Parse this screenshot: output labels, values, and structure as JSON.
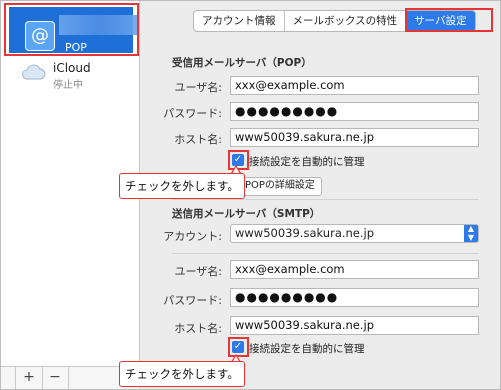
{
  "sidebar": {
    "selected_account": {
      "icon": "at-sign-icon",
      "subtitle": "POP"
    },
    "icloud": {
      "icon": "cloud-icon",
      "name": "iCloud",
      "status": "停止中"
    },
    "add_label": "+",
    "remove_label": "−"
  },
  "tabs": [
    {
      "label": "アカウント情報"
    },
    {
      "label": "メールボックスの特性"
    },
    {
      "label": "サーバ設定"
    }
  ],
  "active_tab": "サーバ設定",
  "incoming": {
    "title": "受信用メールサーバ（POP）",
    "username_label": "ユーザ名:",
    "username": "xxx@example.com",
    "password_label": "パスワード:",
    "password": "●●●●●●●●●",
    "host_label": "ホスト名:",
    "host": "www50039.sakura.ne.jp",
    "auto_manage_label": "接続設定を自動的に管理",
    "auto_manage_checked": true,
    "details_button": "POPの詳細設定"
  },
  "outgoing": {
    "title": "送信用メールサーバ（SMTP）",
    "account_label": "アカウント:",
    "account_value": "www50039.sakura.ne.jp",
    "username_label": "ユーザ名:",
    "username": "xxx@example.com",
    "password_label": "パスワード:",
    "password": "●●●●●●●●●",
    "host_label": "ホスト名:",
    "host": "www50039.sakura.ne.jp",
    "auto_manage_label": "接続設定を自動的に管理",
    "auto_manage_checked": true
  },
  "annotations": {
    "callout_1": "チェックを外します。",
    "callout_2": "チェックを外します。",
    "highlight_color": "#e53535"
  },
  "colors": {
    "accent": "#2d7ae8",
    "selection": "#1f6fd9"
  }
}
